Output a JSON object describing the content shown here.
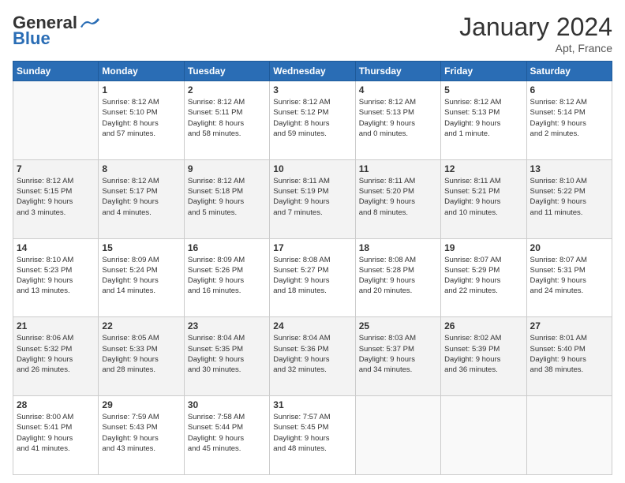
{
  "header": {
    "logo_general": "General",
    "logo_blue": "Blue",
    "month_title": "January 2024",
    "location": "Apt, France"
  },
  "days_of_week": [
    "Sunday",
    "Monday",
    "Tuesday",
    "Wednesday",
    "Thursday",
    "Friday",
    "Saturday"
  ],
  "weeks": [
    {
      "shaded": false,
      "days": [
        {
          "num": "",
          "info": ""
        },
        {
          "num": "1",
          "info": "Sunrise: 8:12 AM\nSunset: 5:10 PM\nDaylight: 8 hours\nand 57 minutes."
        },
        {
          "num": "2",
          "info": "Sunrise: 8:12 AM\nSunset: 5:11 PM\nDaylight: 8 hours\nand 58 minutes."
        },
        {
          "num": "3",
          "info": "Sunrise: 8:12 AM\nSunset: 5:12 PM\nDaylight: 8 hours\nand 59 minutes."
        },
        {
          "num": "4",
          "info": "Sunrise: 8:12 AM\nSunset: 5:13 PM\nDaylight: 9 hours\nand 0 minutes."
        },
        {
          "num": "5",
          "info": "Sunrise: 8:12 AM\nSunset: 5:13 PM\nDaylight: 9 hours\nand 1 minute."
        },
        {
          "num": "6",
          "info": "Sunrise: 8:12 AM\nSunset: 5:14 PM\nDaylight: 9 hours\nand 2 minutes."
        }
      ]
    },
    {
      "shaded": true,
      "days": [
        {
          "num": "7",
          "info": "Sunrise: 8:12 AM\nSunset: 5:15 PM\nDaylight: 9 hours\nand 3 minutes."
        },
        {
          "num": "8",
          "info": "Sunrise: 8:12 AM\nSunset: 5:17 PM\nDaylight: 9 hours\nand 4 minutes."
        },
        {
          "num": "9",
          "info": "Sunrise: 8:12 AM\nSunset: 5:18 PM\nDaylight: 9 hours\nand 5 minutes."
        },
        {
          "num": "10",
          "info": "Sunrise: 8:11 AM\nSunset: 5:19 PM\nDaylight: 9 hours\nand 7 minutes."
        },
        {
          "num": "11",
          "info": "Sunrise: 8:11 AM\nSunset: 5:20 PM\nDaylight: 9 hours\nand 8 minutes."
        },
        {
          "num": "12",
          "info": "Sunrise: 8:11 AM\nSunset: 5:21 PM\nDaylight: 9 hours\nand 10 minutes."
        },
        {
          "num": "13",
          "info": "Sunrise: 8:10 AM\nSunset: 5:22 PM\nDaylight: 9 hours\nand 11 minutes."
        }
      ]
    },
    {
      "shaded": false,
      "days": [
        {
          "num": "14",
          "info": "Sunrise: 8:10 AM\nSunset: 5:23 PM\nDaylight: 9 hours\nand 13 minutes."
        },
        {
          "num": "15",
          "info": "Sunrise: 8:09 AM\nSunset: 5:24 PM\nDaylight: 9 hours\nand 14 minutes."
        },
        {
          "num": "16",
          "info": "Sunrise: 8:09 AM\nSunset: 5:26 PM\nDaylight: 9 hours\nand 16 minutes."
        },
        {
          "num": "17",
          "info": "Sunrise: 8:08 AM\nSunset: 5:27 PM\nDaylight: 9 hours\nand 18 minutes."
        },
        {
          "num": "18",
          "info": "Sunrise: 8:08 AM\nSunset: 5:28 PM\nDaylight: 9 hours\nand 20 minutes."
        },
        {
          "num": "19",
          "info": "Sunrise: 8:07 AM\nSunset: 5:29 PM\nDaylight: 9 hours\nand 22 minutes."
        },
        {
          "num": "20",
          "info": "Sunrise: 8:07 AM\nSunset: 5:31 PM\nDaylight: 9 hours\nand 24 minutes."
        }
      ]
    },
    {
      "shaded": true,
      "days": [
        {
          "num": "21",
          "info": "Sunrise: 8:06 AM\nSunset: 5:32 PM\nDaylight: 9 hours\nand 26 minutes."
        },
        {
          "num": "22",
          "info": "Sunrise: 8:05 AM\nSunset: 5:33 PM\nDaylight: 9 hours\nand 28 minutes."
        },
        {
          "num": "23",
          "info": "Sunrise: 8:04 AM\nSunset: 5:35 PM\nDaylight: 9 hours\nand 30 minutes."
        },
        {
          "num": "24",
          "info": "Sunrise: 8:04 AM\nSunset: 5:36 PM\nDaylight: 9 hours\nand 32 minutes."
        },
        {
          "num": "25",
          "info": "Sunrise: 8:03 AM\nSunset: 5:37 PM\nDaylight: 9 hours\nand 34 minutes."
        },
        {
          "num": "26",
          "info": "Sunrise: 8:02 AM\nSunset: 5:39 PM\nDaylight: 9 hours\nand 36 minutes."
        },
        {
          "num": "27",
          "info": "Sunrise: 8:01 AM\nSunset: 5:40 PM\nDaylight: 9 hours\nand 38 minutes."
        }
      ]
    },
    {
      "shaded": false,
      "days": [
        {
          "num": "28",
          "info": "Sunrise: 8:00 AM\nSunset: 5:41 PM\nDaylight: 9 hours\nand 41 minutes."
        },
        {
          "num": "29",
          "info": "Sunrise: 7:59 AM\nSunset: 5:43 PM\nDaylight: 9 hours\nand 43 minutes."
        },
        {
          "num": "30",
          "info": "Sunrise: 7:58 AM\nSunset: 5:44 PM\nDaylight: 9 hours\nand 45 minutes."
        },
        {
          "num": "31",
          "info": "Sunrise: 7:57 AM\nSunset: 5:45 PM\nDaylight: 9 hours\nand 48 minutes."
        },
        {
          "num": "",
          "info": ""
        },
        {
          "num": "",
          "info": ""
        },
        {
          "num": "",
          "info": ""
        }
      ]
    }
  ]
}
